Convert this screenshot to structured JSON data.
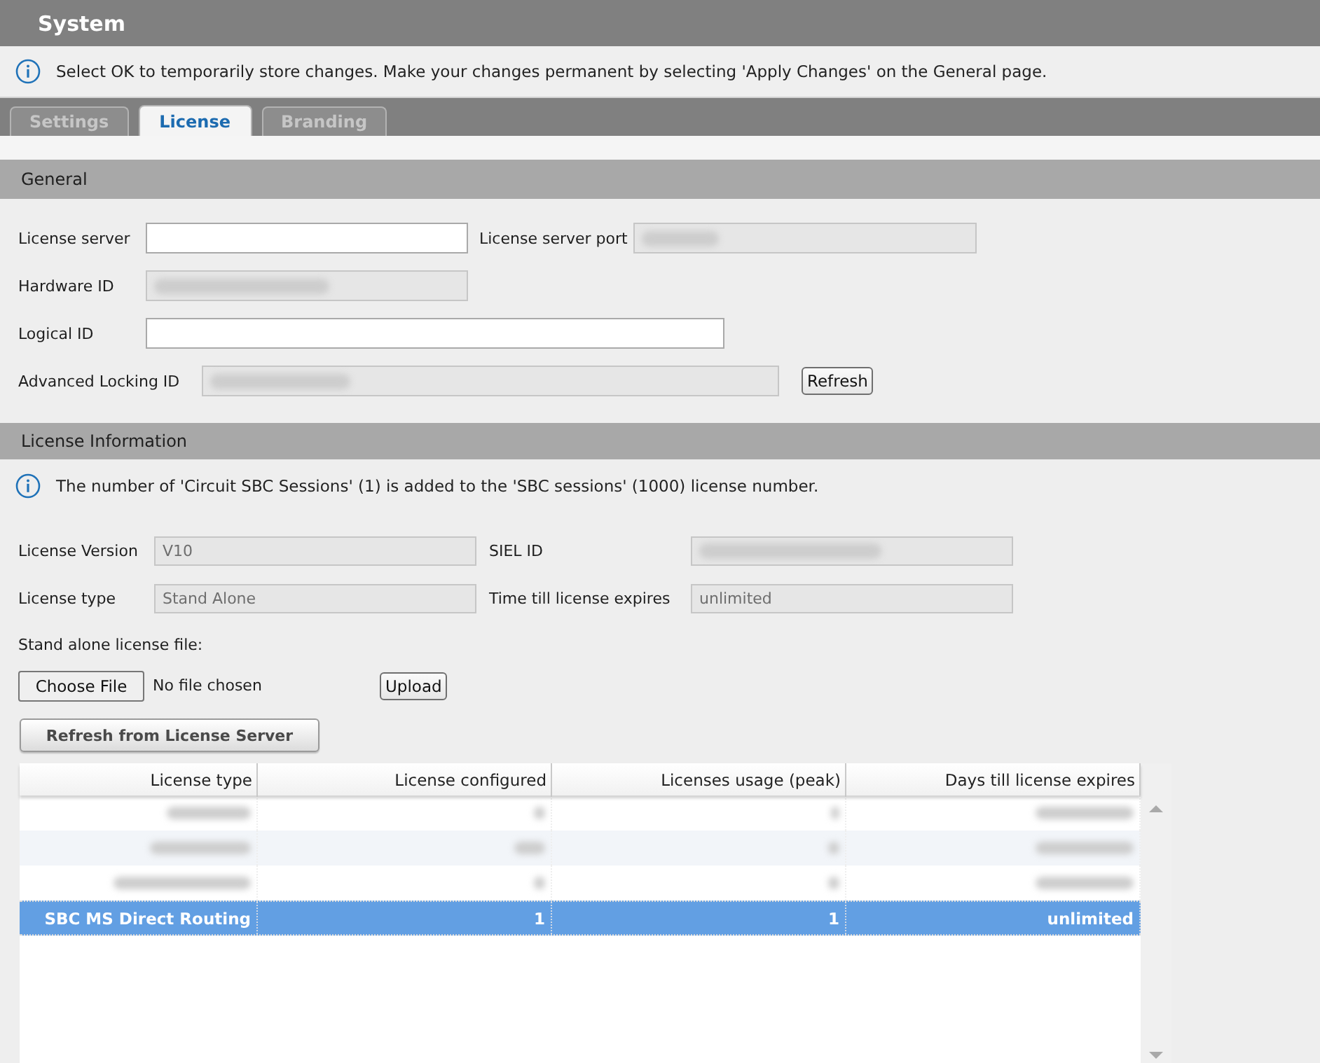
{
  "header": {
    "title": "System"
  },
  "notice": {
    "text": "Select OK to temporarily store changes. Make your changes permanent by selecting 'Apply Changes' on the General page."
  },
  "tabs": [
    {
      "label": "Settings",
      "selected": false
    },
    {
      "label": "License",
      "selected": true
    },
    {
      "label": "Branding",
      "selected": false
    }
  ],
  "general": {
    "title": "General",
    "rows": [
      [
        {
          "kind": "field",
          "label": "License server",
          "disabled": false,
          "redacted": false
        },
        {
          "kind": "field",
          "label": "License server port",
          "disabled": true,
          "redacted": true
        }
      ],
      [
        {
          "kind": "field",
          "label": "Hardware ID",
          "disabled": true,
          "redacted": true
        }
      ],
      [
        {
          "kind": "field",
          "label": "Logical ID",
          "disabled": false,
          "redacted": false
        }
      ],
      [
        {
          "kind": "field",
          "label": "Advanced Locking ID",
          "disabled": true,
          "redacted": true
        },
        {
          "kind": "button",
          "label": "Refresh"
        }
      ]
    ]
  },
  "license_information": {
    "title": "License Information",
    "notice": "The number of 'Circuit SBC Sessions' (1) is added to the 'SBC sessions' (1000) license number.",
    "rows": [
      [
        {
          "kind": "field",
          "label": "License Version",
          "value": "V10",
          "disabled": true,
          "redacted": false
        },
        {
          "kind": "field",
          "label": "SIEL ID",
          "disabled": true,
          "redacted": true
        }
      ],
      [
        {
          "kind": "field",
          "label": "License type",
          "value": "Stand Alone",
          "disabled": true,
          "redacted": false
        },
        {
          "kind": "field",
          "label": "Time till license expires",
          "value": "unlimited",
          "disabled": true,
          "redacted": false
        }
      ]
    ],
    "file_label": "Stand alone license file:",
    "file_button": "Choose File",
    "file_status": "No file chosen",
    "upload_button": "Upload",
    "refresh_button": "Refresh from License Server"
  },
  "table": {
    "columns": [
      "License type",
      "License configured",
      "Licenses usage (peak)",
      "Days till license expires"
    ],
    "rows": [
      {
        "redacted": true,
        "selected": false
      },
      {
        "redacted": true,
        "selected": false
      },
      {
        "redacted": true,
        "selected": false
      },
      {
        "cells": [
          "SBC MS Direct Routing",
          "1",
          "1",
          "unlimited"
        ],
        "redacted": false,
        "selected": true
      }
    ]
  }
}
